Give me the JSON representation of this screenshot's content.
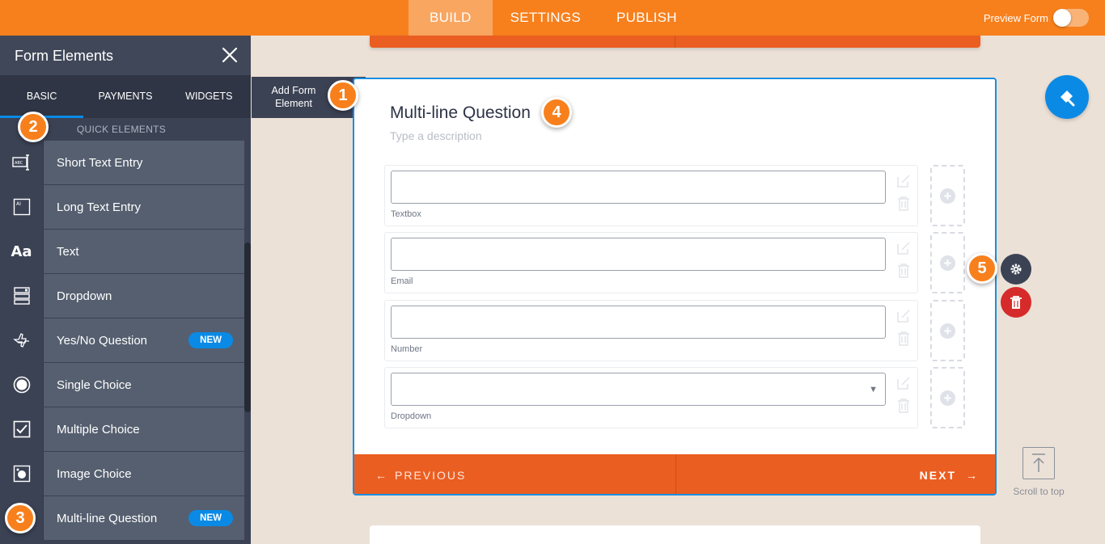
{
  "topbar": {
    "nav": [
      {
        "label": "BUILD",
        "active": true
      },
      {
        "label": "SETTINGS",
        "active": false
      },
      {
        "label": "PUBLISH",
        "active": false
      }
    ],
    "preview_label": "Preview Form"
  },
  "sidebar": {
    "title": "Form Elements",
    "tabs": [
      {
        "label": "BASIC",
        "active": true
      },
      {
        "label": "PAYMENTS",
        "active": false
      },
      {
        "label": "WIDGETS",
        "active": false
      }
    ],
    "section": "QUICK ELEMENTS",
    "items": [
      {
        "label": "Short Text Entry",
        "icon": "short-text-icon",
        "badge": ""
      },
      {
        "label": "Long Text Entry",
        "icon": "long-text-icon",
        "badge": ""
      },
      {
        "label": "Text",
        "icon": "text-aa-icon",
        "badge": ""
      },
      {
        "label": "Dropdown",
        "icon": "dropdown-icon",
        "badge": ""
      },
      {
        "label": "Yes/No Question",
        "icon": "yes-no-icon",
        "badge": "NEW"
      },
      {
        "label": "Single Choice",
        "icon": "radio-icon",
        "badge": ""
      },
      {
        "label": "Multiple Choice",
        "icon": "checkbox-icon",
        "badge": ""
      },
      {
        "label": "Image Choice",
        "icon": "image-choice-icon",
        "badge": ""
      },
      {
        "label": "Multi-line Question",
        "icon": "multiline-icon",
        "badge": "NEW"
      }
    ]
  },
  "add_element": {
    "line1": "Add Form",
    "line2": "Element"
  },
  "badges": [
    "1",
    "2",
    "3",
    "4",
    "5"
  ],
  "question": {
    "title": "Multi-line Question",
    "description_placeholder": "Type a description",
    "fields": [
      {
        "sublabel": "Textbox",
        "type": "text"
      },
      {
        "sublabel": "Email",
        "type": "text"
      },
      {
        "sublabel": "Number",
        "type": "text"
      },
      {
        "sublabel": "Dropdown",
        "type": "select"
      }
    ]
  },
  "footer": {
    "previous": "PREVIOUS",
    "next": "NEXT"
  },
  "scroll_top_label": "Scroll to top",
  "colors": {
    "accent_orange": "#f7801d",
    "footer_orange": "#eb5e21",
    "sidebar_dark": "#3b4254",
    "blue": "#0a8ae5",
    "delete_red": "#d62b2b"
  }
}
